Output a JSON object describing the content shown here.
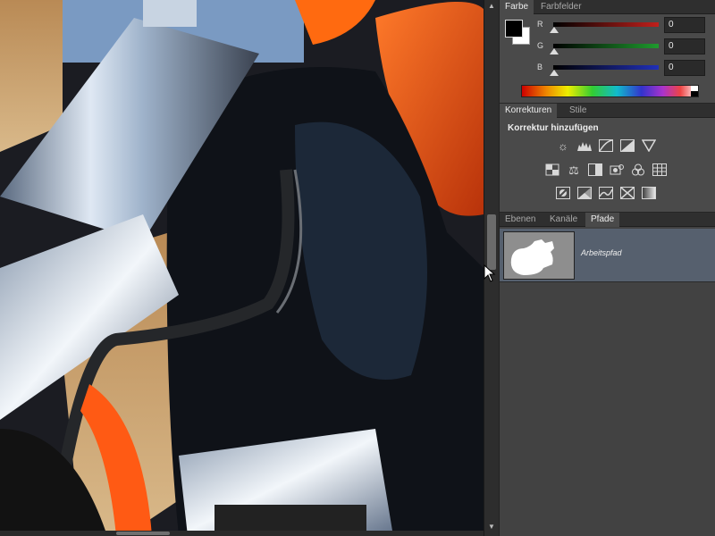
{
  "colors": {
    "panel_bg": "#4a4a4a",
    "selected_row": "#56606e",
    "red_channel": "#c0201c",
    "green_channel": "#1f9a2e",
    "blue_channel": "#2030b8"
  },
  "color_panel": {
    "tabs": [
      {
        "label": "Farbe",
        "active": true
      },
      {
        "label": "Farbfelder",
        "active": false
      }
    ],
    "foreground": "#000000",
    "background": "#ffffff",
    "channels": [
      {
        "label": "R",
        "value": "0"
      },
      {
        "label": "G",
        "value": "0"
      },
      {
        "label": "B",
        "value": "0"
      }
    ]
  },
  "adjustments_panel": {
    "tabs": [
      {
        "label": "Korrekturen",
        "active": true
      },
      {
        "label": "Stile",
        "active": false
      }
    ],
    "title": "Korrektur hinzufügen",
    "icon_rows": [
      [
        "brightness-icon",
        "levels-icon",
        "curves-icon",
        "exposure-icon",
        "vibrance-icon"
      ],
      [
        "hue-saturation-icon",
        "color-balance-icon",
        "black-white-icon",
        "photo-filter-icon",
        "channel-mixer-icon",
        "color-lookup-icon"
      ],
      [
        "invert-icon",
        "posterize-icon",
        "threshold-icon",
        "selective-color-icon",
        "gradient-map-icon"
      ]
    ]
  },
  "paths_panel": {
    "tabs": [
      {
        "label": "Ebenen",
        "active": false
      },
      {
        "label": "Kanäle",
        "active": false
      },
      {
        "label": "Pfade",
        "active": true
      }
    ],
    "paths": [
      {
        "name": "Arbeitspfad"
      }
    ]
  }
}
